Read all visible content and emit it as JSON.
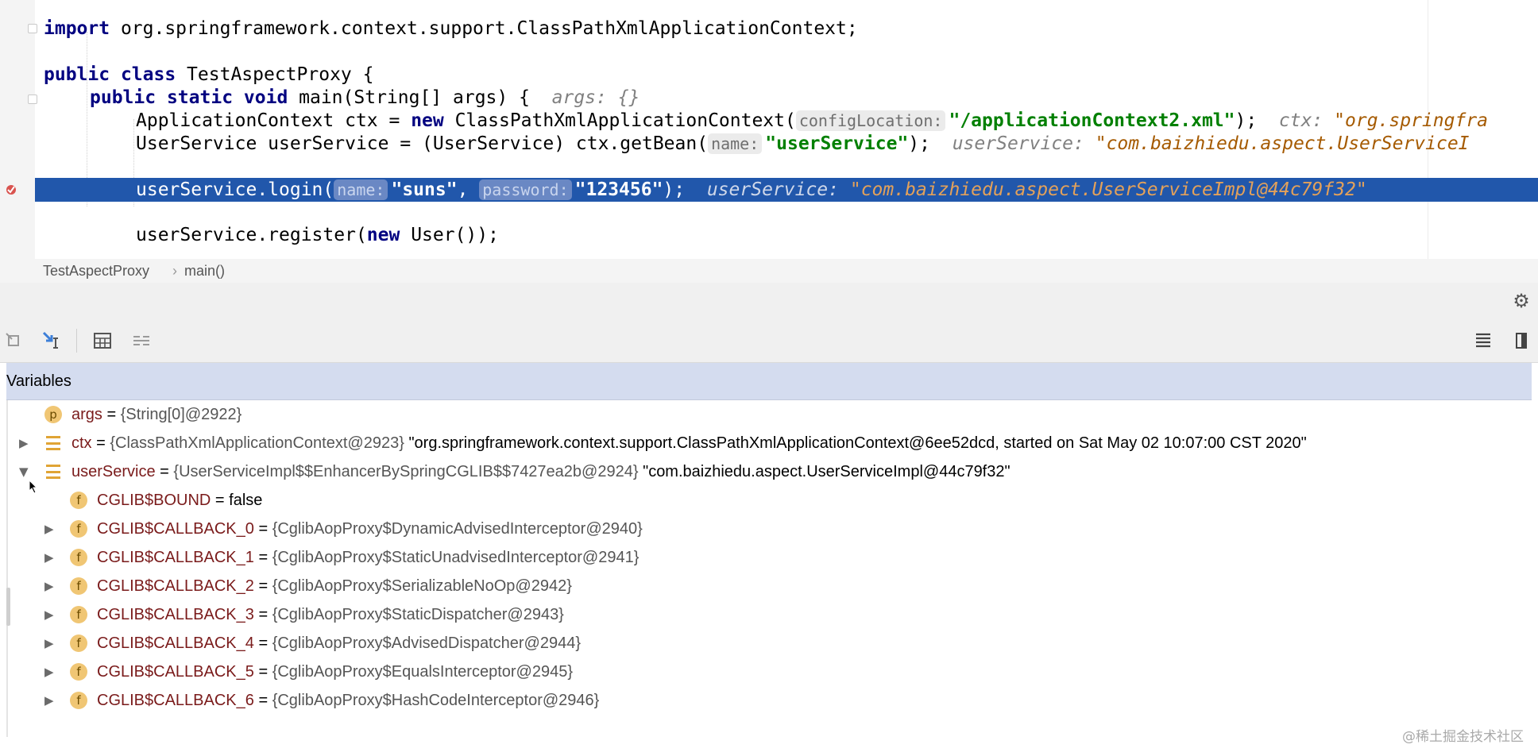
{
  "editor": {
    "lines": {
      "import": {
        "kw": "import",
        "rest": " org.springframework.context.support.ClassPathXmlApplicationContext;"
      },
      "class_decl": {
        "kw1": "public",
        "kw2": "class",
        "name": " TestAspectProxy {"
      },
      "main_decl": {
        "kw1": "public",
        "kw2": "static",
        "kw3": "void",
        "sig": " main(String[] args) {",
        "hint": "args: {}"
      },
      "ctx_line": {
        "pre": "ApplicationContext ctx = ",
        "kw": "new",
        "mid": " ClassPathXmlApplicationContext(",
        "param": "configLocation:",
        "str": "\"/applicationContext2.xml\"",
        "post": ");",
        "hint_label": "ctx: ",
        "hint_val": "\"org.springfra"
      },
      "userservice_line": {
        "pre": "UserService userService = (UserService) ctx.getBean(",
        "param": "name:",
        "str": "\"userService\"",
        "post": ");",
        "hint_label": "userService: ",
        "hint_val": "\"com.baizhiedu.aspect.UserServiceI"
      },
      "login_line": {
        "pre": "userService.login(",
        "param1": "name:",
        "str1": "\"suns\"",
        "sep": ", ",
        "param2": "password:",
        "str2": "\"123456\"",
        "post": ");",
        "hint_label": "userService: ",
        "hint_val": "\"com.baizhiedu.aspect.UserServiceImpl@44c79f32\""
      },
      "register_line": {
        "pre": "userService.register(",
        "kw": "new",
        "post": " User());"
      }
    }
  },
  "breadcrumb": {
    "class": "TestAspectProxy",
    "sep": "›",
    "method": "main()"
  },
  "variables": {
    "title": "Variables",
    "rows": [
      {
        "badge": "p",
        "name": "args",
        "eq": " = ",
        "type": "{String[0]@2922}",
        "value": ""
      },
      {
        "name": "ctx",
        "eq": " = ",
        "type": "{ClassPathXmlApplicationContext@2923}",
        "value": " \"org.springframework.context.support.ClassPathXmlApplicationContext@6ee52dcd, started on Sat May 02 10:07:00 CST 2020\""
      },
      {
        "name": "userService",
        "eq": " = ",
        "type": "{UserServiceImpl$$EnhancerBySpringCGLIB$$7427ea2b@2924}",
        "value": " \"com.baizhiedu.aspect.UserServiceImpl@44c79f32\""
      },
      {
        "badge": "f",
        "name": "CGLIB$BOUND",
        "eq": " = ",
        "type": "",
        "value": "false"
      },
      {
        "badge": "f",
        "name": "CGLIB$CALLBACK_0",
        "eq": " = ",
        "type": "{CglibAopProxy$DynamicAdvisedInterceptor@2940}",
        "value": ""
      },
      {
        "badge": "f",
        "name": "CGLIB$CALLBACK_1",
        "eq": " = ",
        "type": "{CglibAopProxy$StaticUnadvisedInterceptor@2941}",
        "value": ""
      },
      {
        "badge": "f",
        "name": "CGLIB$CALLBACK_2",
        "eq": " = ",
        "type": "{CglibAopProxy$SerializableNoOp@2942}",
        "value": ""
      },
      {
        "badge": "f",
        "name": "CGLIB$CALLBACK_3",
        "eq": " = ",
        "type": "{CglibAopProxy$StaticDispatcher@2943}",
        "value": ""
      },
      {
        "badge": "f",
        "name": "CGLIB$CALLBACK_4",
        "eq": " = ",
        "type": "{CglibAopProxy$AdvisedDispatcher@2944}",
        "value": ""
      },
      {
        "badge": "f",
        "name": "CGLIB$CALLBACK_5",
        "eq": " = ",
        "type": "{CglibAopProxy$EqualsInterceptor@2945}",
        "value": ""
      },
      {
        "badge": "f",
        "name": "CGLIB$CALLBACK_6",
        "eq": " = ",
        "type": "{CglibAopProxy$HashCodeInterceptor@2946}",
        "value": ""
      }
    ]
  },
  "icons": {
    "expand": "▶",
    "collapse": "▼",
    "gear": "⚙",
    "settings": "gear-icon",
    "restore": "restore-layout-icon",
    "step_into": "force-step-into-icon",
    "evaluate": "evaluate-expression-icon",
    "trace": "trace-current-stream-icon",
    "layout": "restore-layout-icon",
    "more": "more-icon"
  },
  "watermark": "@稀土掘金技术社区",
  "colors": {
    "highlight": "#2157ab",
    "variables_header": "#d4dcef",
    "keyword": "#000080",
    "string": "#008000",
    "field_badge": "#f0c674"
  }
}
